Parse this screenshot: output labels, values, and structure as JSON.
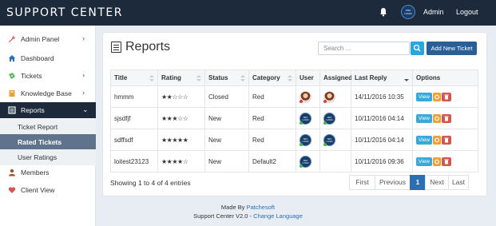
{
  "app": {
    "title": "SUPPORT CENTER"
  },
  "topbar": {
    "user": "Admin",
    "logout": "Logout",
    "avatar_line1": "PRO",
    "avatar_line2": "LOGIN"
  },
  "sidebar": {
    "items": [
      {
        "label": "Admin Panel",
        "icon": "wrench-icon",
        "color": "#d9534f",
        "chevron": "›"
      },
      {
        "label": "Dashboard",
        "icon": "home-icon",
        "color": "#2a6fb5"
      },
      {
        "label": "Tickets",
        "icon": "ticket-icon",
        "color": "#5cb85c",
        "chevron": "›"
      },
      {
        "label": "Knowledge Base",
        "icon": "book-icon",
        "color": "#f0a030",
        "chevron": "›"
      },
      {
        "label": "Reports",
        "icon": "list-icon",
        "color": "#ffffff",
        "chevron": "⌄"
      }
    ],
    "sub_items": [
      {
        "label": "Ticket Report"
      },
      {
        "label": "Rated Tickets"
      },
      {
        "label": "User Ratings"
      }
    ],
    "bottom_items": [
      {
        "label": "Members",
        "icon": "user-icon",
        "color": "#a0522d"
      },
      {
        "label": "Client View",
        "icon": "heart-icon",
        "color": "#d9534f"
      }
    ]
  },
  "main": {
    "title": "Reports",
    "search_placeholder": "Search ...",
    "new_ticket": "Add New Ticket",
    "columns": [
      "Title",
      "Rating",
      "Status",
      "Category",
      "User",
      "Assigned",
      "Last Reply",
      "Options"
    ],
    "rows": [
      {
        "title": "hmmm",
        "rating": "★★☆☆☆",
        "status": "Closed",
        "category": "Red",
        "user": "photo",
        "assigned": "photo",
        "last_reply": "14/11/2016 10:35"
      },
      {
        "title": "sjsdfjf",
        "rating": "★★★☆☆",
        "status": "New",
        "category": "Red",
        "user": "logo",
        "assigned": "logo",
        "last_reply": "10/11/2016 04:14"
      },
      {
        "title": "sdffsdf",
        "rating": "★★★★★",
        "status": "New",
        "category": "Red",
        "user": "logo",
        "assigned": "logo",
        "last_reply": "10/11/2016 04:14"
      },
      {
        "title": "loitest23123",
        "rating": "★★★★☆",
        "status": "New",
        "category": "Default2",
        "user": "logo",
        "assigned": "",
        "last_reply": "10/11/2016 09:36"
      }
    ],
    "view_label": "View",
    "showing": "Showing 1 to 4 of 4 entries",
    "pager": [
      "First",
      "Previous",
      "1",
      "Next",
      "Last"
    ],
    "pager_active": "1"
  },
  "footer": {
    "made_by": "Made By",
    "made_by_link": "Patchesoft",
    "version": "Support Center V2.0 -",
    "change_language": "Change Language"
  },
  "colors": {
    "topbar": "#1c2a3c",
    "accent": "#2a6fb5",
    "view": "#38a9dd",
    "settings": "#f0a030",
    "delete": "#d9534f"
  }
}
